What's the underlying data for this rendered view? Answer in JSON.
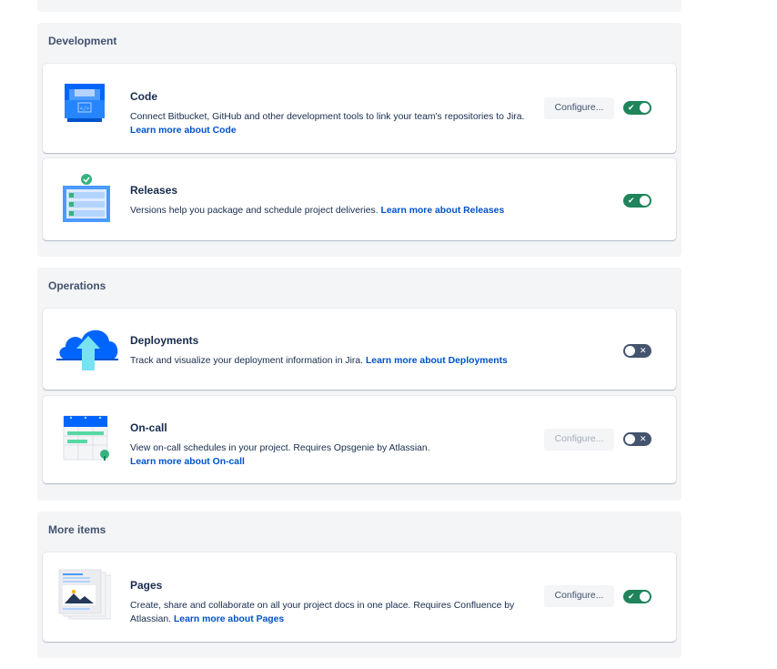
{
  "sections": {
    "development": {
      "title": "Development",
      "code": {
        "title": "Code",
        "description": "Connect Bitbucket, GitHub and other development tools to link your team's repositories to Jira.",
        "link": "Learn more about Code",
        "configure_label": "Configure...",
        "enabled": true,
        "icon": "code-repository-icon"
      },
      "releases": {
        "title": "Releases",
        "description": "Versions help you package and schedule project deliveries.",
        "link": "Learn more about Releases",
        "enabled": true,
        "icon": "releases-checklist-icon"
      }
    },
    "operations": {
      "title": "Operations",
      "deployments": {
        "title": "Deployments",
        "description": "Track and visualize your deployment information in Jira.",
        "link": "Learn more about Deployments",
        "enabled": false,
        "icon": "cloud-upload-icon"
      },
      "oncall": {
        "title": "On-call",
        "description": "View on-call schedules in your project. Requires Opsgenie by Atlassian.",
        "link": "Learn more about On-call",
        "configure_label": "Configure...",
        "configure_disabled": true,
        "enabled": false,
        "icon": "calendar-schedule-icon"
      }
    },
    "more": {
      "title": "More items",
      "pages": {
        "title": "Pages",
        "description": "Create, share and collaborate on all your project docs in one place. Requires Confluence by Atlassian.",
        "link": "Learn more about Pages",
        "configure_label": "Configure...",
        "enabled": true,
        "icon": "pages-documents-icon"
      }
    }
  },
  "colors": {
    "toggle_on": "#1f845a",
    "toggle_off": "#44546f",
    "link": "#0052cc",
    "section_bg": "#f4f5f7"
  }
}
